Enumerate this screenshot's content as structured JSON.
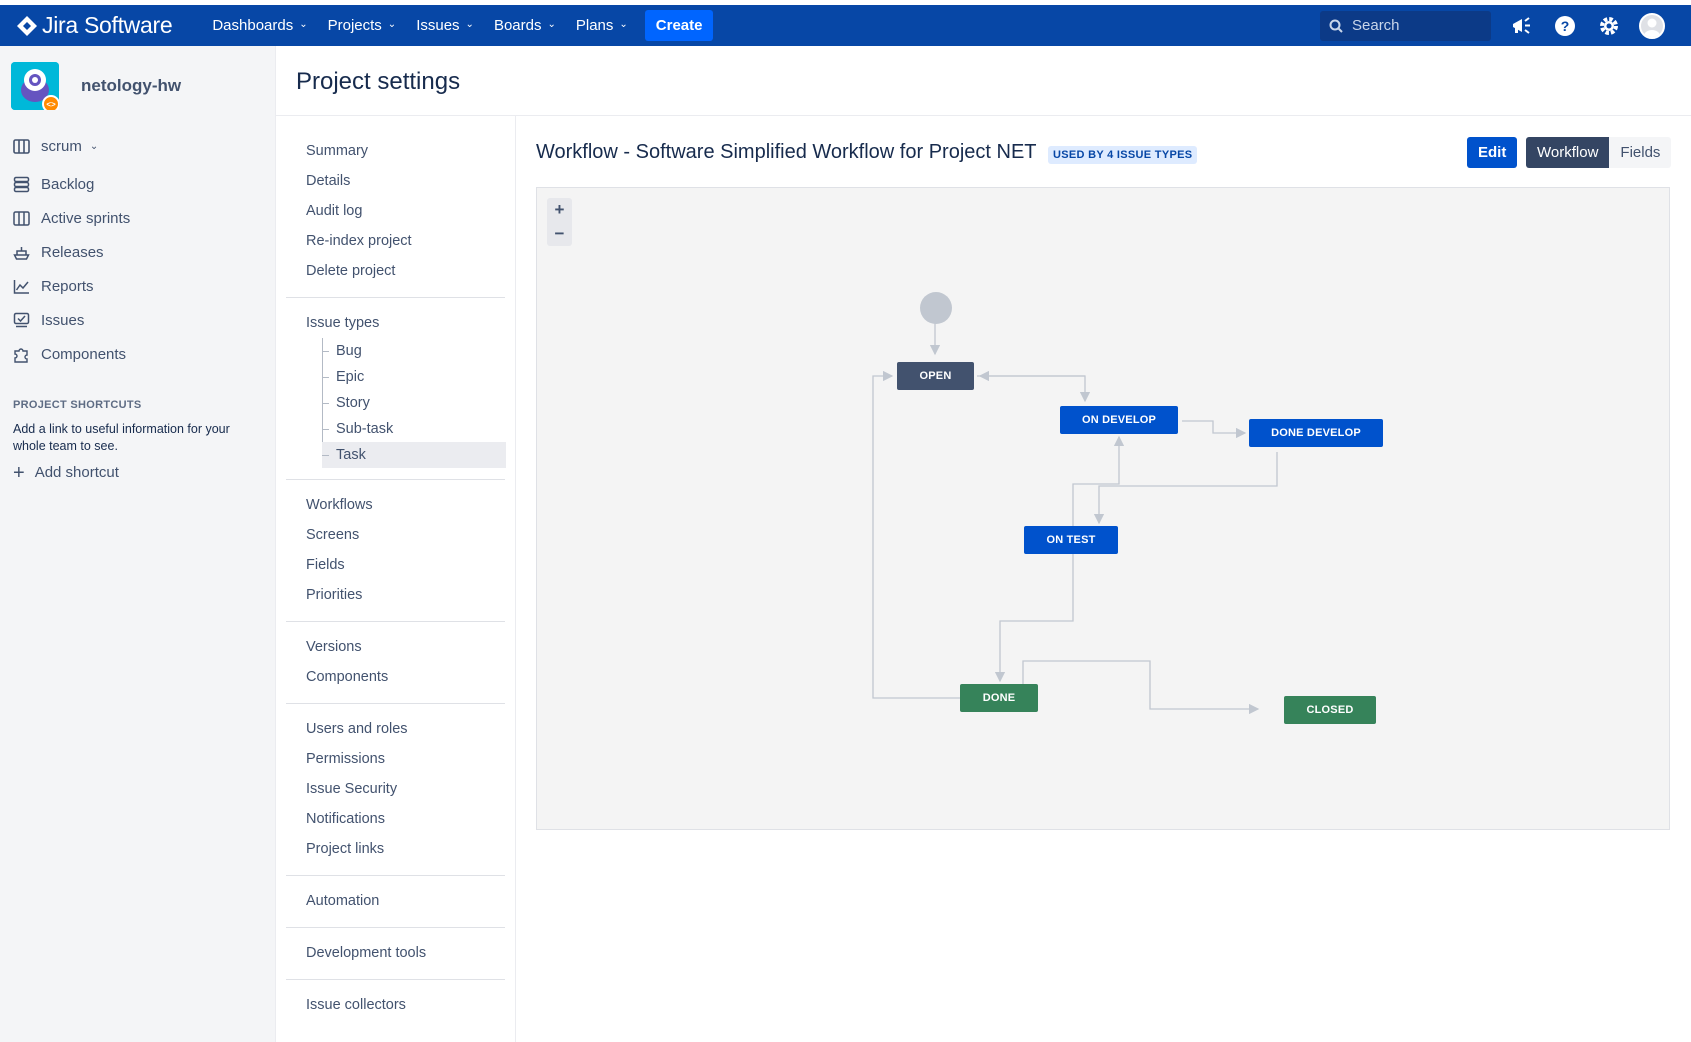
{
  "topbar": {
    "logo_text": "Jira Software",
    "nav": [
      {
        "label": "Dashboards"
      },
      {
        "label": "Projects"
      },
      {
        "label": "Issues"
      },
      {
        "label": "Boards"
      },
      {
        "label": "Plans"
      }
    ],
    "create_label": "Create",
    "search_placeholder": "Search",
    "accent_color": "#0747a6"
  },
  "sidebar": {
    "project_name": "netology-hw",
    "board_selector": "scrum",
    "items": [
      {
        "label": "Backlog",
        "icon": "backlog-icon"
      },
      {
        "label": "Active sprints",
        "icon": "board-icon"
      },
      {
        "label": "Releases",
        "icon": "ship-icon"
      },
      {
        "label": "Reports",
        "icon": "chart-icon"
      },
      {
        "label": "Issues",
        "icon": "issues-icon"
      },
      {
        "label": "Components",
        "icon": "puzzle-icon"
      }
    ],
    "shortcuts_heading": "PROJECT SHORTCUTS",
    "shortcuts_text": "Add a link to useful information for your whole team to see.",
    "add_shortcut_label": "Add shortcut"
  },
  "header": {
    "title": "Project settings"
  },
  "settings_nav": {
    "group1": [
      "Summary",
      "Details",
      "Audit log",
      "Re-index project",
      "Delete project"
    ],
    "issue_types_label": "Issue types",
    "issue_types": [
      "Bug",
      "Epic",
      "Story",
      "Sub-task",
      "Task"
    ],
    "active_issue_type": "Task",
    "group3": [
      "Workflows",
      "Screens",
      "Fields",
      "Priorities"
    ],
    "group4": [
      "Versions",
      "Components"
    ],
    "group5": [
      "Users and roles",
      "Permissions",
      "Issue Security",
      "Notifications",
      "Project links"
    ],
    "group6": [
      "Automation"
    ],
    "group7": [
      "Development tools"
    ],
    "group8": [
      "Issue collectors"
    ]
  },
  "main": {
    "workflow_title": "Workflow - Software Simplified Workflow for Project NET",
    "badge": "USED BY 4 ISSUE TYPES",
    "edit_label": "Edit",
    "view_toggle": [
      "Workflow",
      "Fields"
    ],
    "active_view": "Workflow",
    "zoom_in": "+",
    "zoom_out": "−"
  },
  "workflow": {
    "statuses": [
      {
        "id": "open",
        "label": "OPEN",
        "category": "todo",
        "color": "#42526e"
      },
      {
        "id": "on_develop",
        "label": "ON DEVELOP",
        "category": "in-progress",
        "color": "#0052cc"
      },
      {
        "id": "done_develop",
        "label": "DONE DEVELOP",
        "category": "in-progress",
        "color": "#0052cc"
      },
      {
        "id": "on_test",
        "label": "ON TEST",
        "category": "in-progress",
        "color": "#0052cc"
      },
      {
        "id": "done",
        "label": "DONE",
        "category": "done",
        "color": "#36835a"
      },
      {
        "id": "closed",
        "label": "CLOSED",
        "category": "done",
        "color": "#36835a"
      }
    ]
  }
}
